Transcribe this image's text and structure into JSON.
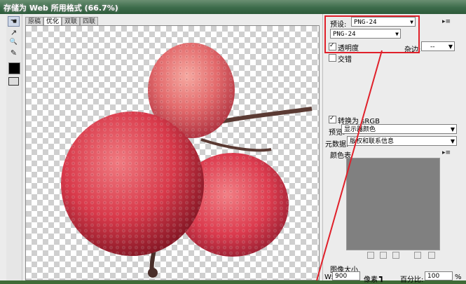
{
  "window": {
    "title": "存储为 Web 所用格式 (66.7%)"
  },
  "tools": [
    {
      "name": "hand-tool-icon",
      "glyph": "☚"
    },
    {
      "name": "slice-select-tool-icon",
      "glyph": "↗"
    },
    {
      "name": "zoom-tool-icon",
      "glyph": "🔍"
    },
    {
      "name": "eyedropper-tool-icon",
      "glyph": "✎"
    }
  ],
  "view": {
    "tabs": [
      "原稿",
      "优化",
      "双联",
      "四联"
    ],
    "active_tab": 1
  },
  "panel": {
    "preset_label": "预设:",
    "preset_value": "PNG-24",
    "format_value": "PNG-24",
    "transparency_label": "透明度",
    "transparency_checked": true,
    "matte_label": "杂边:",
    "matte_value": "--",
    "interlaced_label": "交错",
    "interlaced_checked": false,
    "convert_srgb_label": "转换为 sRGB",
    "convert_srgb_checked": true,
    "preview_label": "预览:",
    "preview_value": "显示器颜色",
    "metadata_label": "元数据:",
    "metadata_value": "版权和联系信息",
    "color_table_label": "颜色表",
    "image_size_label": "图像大小",
    "width_label": "W:",
    "width_value": "900",
    "unit_label": "像素",
    "percent_label": "百分比:",
    "percent_value": "100",
    "percent_unit": "%"
  },
  "colors": {
    "highlight": "#e0202a",
    "color_table_fill": "#808080",
    "checker_dark": "#cfcfcf"
  }
}
